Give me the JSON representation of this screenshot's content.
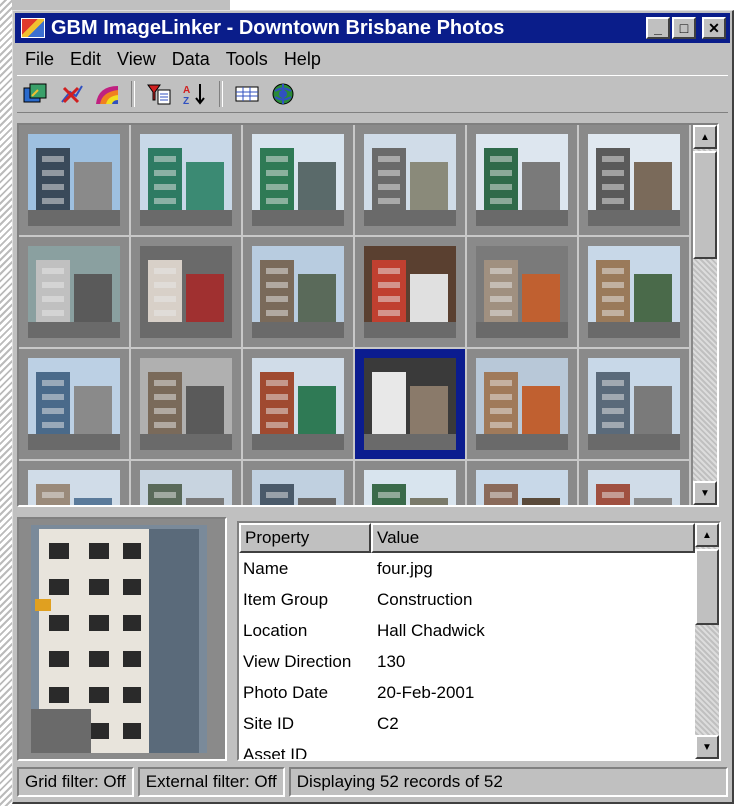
{
  "window": {
    "title": "GBM ImageLinker - Downtown Brisbane Photos",
    "minimize_glyph": "_",
    "maximize_glyph": "□",
    "close_glyph": "✕"
  },
  "menu": [
    {
      "label": "File"
    },
    {
      "label": "Edit"
    },
    {
      "label": "View"
    },
    {
      "label": "Data"
    },
    {
      "label": "Tools"
    },
    {
      "label": "Help"
    }
  ],
  "toolbar": {
    "icons": [
      "link-image-icon",
      "unlink-image-icon",
      "color-ramp-icon",
      "filter-icon",
      "sort-ascending-icon",
      "grid-view-icon",
      "globe-icon"
    ]
  },
  "thumbnails": [
    {
      "icon": "building-photo-thumbnail",
      "colors": [
        "#3a4a5a",
        "#8a8a8a",
        "#9ec0e0"
      ]
    },
    {
      "icon": "building-photo-thumbnail",
      "colors": [
        "#2e7b63",
        "#3b8a73",
        "#c8d8e8"
      ]
    },
    {
      "icon": "building-photo-thumbnail",
      "colors": [
        "#2f7a55",
        "#5a6a6a",
        "#d8e4ee"
      ]
    },
    {
      "icon": "building-photo-thumbnail",
      "colors": [
        "#6a6a6a",
        "#8a8a7a",
        "#d0dce8"
      ]
    },
    {
      "icon": "building-photo-thumbnail",
      "colors": [
        "#2f6a4a",
        "#7a7a7a",
        "#dde6ef"
      ]
    },
    {
      "icon": "building-photo-thumbnail",
      "colors": [
        "#5a5a5a",
        "#7a6a5a",
        "#e0e8f0"
      ]
    },
    {
      "icon": "building-photo-thumbnail",
      "colors": [
        "#c0c0c0",
        "#5a5a5a",
        "#8aa0a0"
      ]
    },
    {
      "icon": "building-photo-thumbnail",
      "colors": [
        "#d8d0c8",
        "#a03030",
        "#6a6a6a"
      ]
    },
    {
      "icon": "building-photo-thumbnail",
      "colors": [
        "#7a6a5a",
        "#5a6a5a",
        "#b8cce0"
      ]
    },
    {
      "icon": "building-photo-thumbnail",
      "colors": [
        "#c04030",
        "#e0e0e0",
        "#5a4030"
      ]
    },
    {
      "icon": "building-photo-thumbnail",
      "colors": [
        "#a09080",
        "#c06030",
        "#7a7a7a"
      ]
    },
    {
      "icon": "building-photo-thumbnail",
      "colors": [
        "#9a7a5a",
        "#4a6a4a",
        "#c8d8e8"
      ]
    },
    {
      "icon": "building-photo-thumbnail",
      "colors": [
        "#4a6a8a",
        "#8a8a8a",
        "#bcd0e4"
      ]
    },
    {
      "icon": "building-photo-thumbnail",
      "colors": [
        "#7a6a5a",
        "#5a5a5a",
        "#b0b0b0"
      ]
    },
    {
      "icon": "building-photo-thumbnail",
      "colors": [
        "#a04a30",
        "#2f7a55",
        "#d0dce8"
      ]
    },
    {
      "icon": "building-photo-thumbnail",
      "colors": [
        "#e8e8e8",
        "#8a7a6a",
        "#3a3a3a"
      ]
    },
    {
      "icon": "building-photo-thumbnail",
      "colors": [
        "#a07a5a",
        "#c06030",
        "#b8c8d8"
      ]
    },
    {
      "icon": "building-photo-thumbnail",
      "colors": [
        "#5a6a7a",
        "#7a7a7a",
        "#c8d8e8"
      ]
    },
    {
      "icon": "building-photo-thumbnail",
      "colors": [
        "#9a8a7a",
        "#5a7a9a",
        "#d0dce8"
      ]
    },
    {
      "icon": "building-photo-thumbnail",
      "colors": [
        "#5a6a5a",
        "#7a7a7a",
        "#c8d4e0"
      ]
    },
    {
      "icon": "building-photo-thumbnail",
      "colors": [
        "#4a5a6a",
        "#6a6a6a",
        "#c0d0e0"
      ]
    },
    {
      "icon": "building-photo-thumbnail",
      "colors": [
        "#3a6a4a",
        "#7a7a6a",
        "#d8e4ee"
      ]
    },
    {
      "icon": "building-photo-thumbnail",
      "colors": [
        "#8a6a5a",
        "#5a4a3a",
        "#c8d8e8"
      ]
    },
    {
      "icon": "building-photo-thumbnail",
      "colors": [
        "#a05040",
        "#8a8a8a",
        "#d0dce8"
      ]
    }
  ],
  "selected_index": 15,
  "properties": {
    "headers": [
      "Property",
      "Value"
    ],
    "rows": [
      [
        "Name",
        "four.jpg"
      ],
      [
        "Item Group",
        "Construction"
      ],
      [
        "Location",
        "Hall Chadwick"
      ],
      [
        "View Direction",
        "130"
      ],
      [
        "Photo Date",
        "20-Feb-2001"
      ],
      [
        "Site ID",
        "C2"
      ],
      [
        "Asset ID",
        ""
      ]
    ]
  },
  "status": {
    "grid_filter": "Grid filter: Off",
    "external_filter": "External filter: Off",
    "records": "Displaying 52 records of 52"
  }
}
